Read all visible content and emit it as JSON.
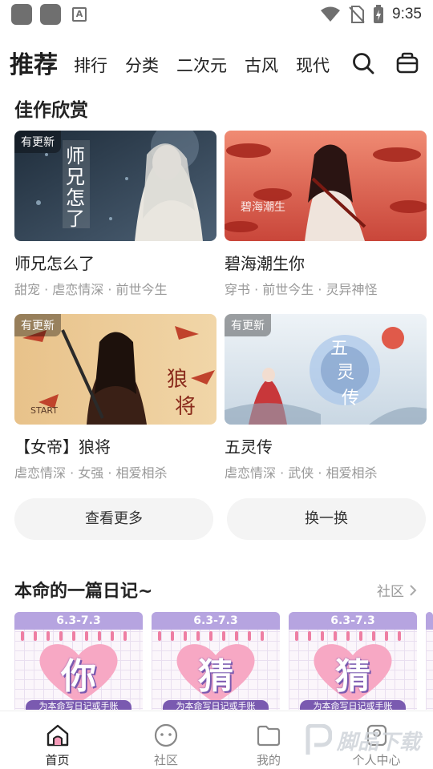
{
  "status_bar": {
    "time": "9:35",
    "app_letter": "A"
  },
  "top_nav": {
    "active_tab": "推荐",
    "tabs": [
      "排行",
      "分类",
      "二次元",
      "古风",
      "现代"
    ]
  },
  "featured": {
    "title": "佳作欣赏",
    "badge": "有更新",
    "cards": [
      {
        "title": "师兄怎么了",
        "tags": "甜宠 · 虐恋情深 · 前世今生",
        "has_badge": true,
        "cover": {
          "base": "#2b3a4a",
          "accent": "#8fa4b8",
          "lettering": "师兄怎么了"
        }
      },
      {
        "title": "碧海潮生你",
        "tags": "穿书 · 前世今生 · 灵异神怪",
        "has_badge": false,
        "cover": {
          "base": "#e86b58",
          "accent": "#f6d3c7",
          "lettering": "碧海潮生"
        }
      },
      {
        "title": "【女帝】狼将",
        "tags": "虐恋情深 · 女强 · 相爱相杀",
        "has_badge": true,
        "cover": {
          "base": "#d69a5a",
          "accent": "#8a2b1c",
          "lettering": "狼将"
        }
      },
      {
        "title": "五灵传",
        "tags": "虐恋情深 · 武侠 · 相爱相杀",
        "has_badge": true,
        "cover": {
          "base": "#dfe8ef",
          "accent": "#6d8fbf",
          "lettering": "五灵传"
        }
      }
    ]
  },
  "actions": {
    "more_label": "查看更多",
    "refresh_label": "换一换"
  },
  "diary": {
    "title": "本命的一篇日记~",
    "more_label": "社区",
    "cards": [
      {
        "date": "6.3-7.3",
        "char": "你",
        "footer": "为本命写日记或手账"
      },
      {
        "date": "6.3-7.3",
        "char": "猜",
        "footer": "为本命写日记或手账"
      },
      {
        "date": "6.3-7.3",
        "char": "猜",
        "footer": "为本命写日记或手账"
      }
    ]
  },
  "bottom_nav": {
    "items": [
      {
        "label": "首页",
        "icon": "home-icon",
        "active": true
      },
      {
        "label": "社区",
        "icon": "community-icon",
        "active": false
      },
      {
        "label": "我的",
        "icon": "folder-icon",
        "active": false
      },
      {
        "label": "个人中心",
        "icon": "profile-icon",
        "active": false
      }
    ]
  },
  "watermark": {
    "text": "脚品下载"
  },
  "colors": {
    "text_primary": "#222222",
    "text_secondary": "#999999",
    "pill_bg": "#f4f4f4",
    "diary_accent": "#b6a4e0",
    "diary_pink": "#ee7fa3"
  }
}
